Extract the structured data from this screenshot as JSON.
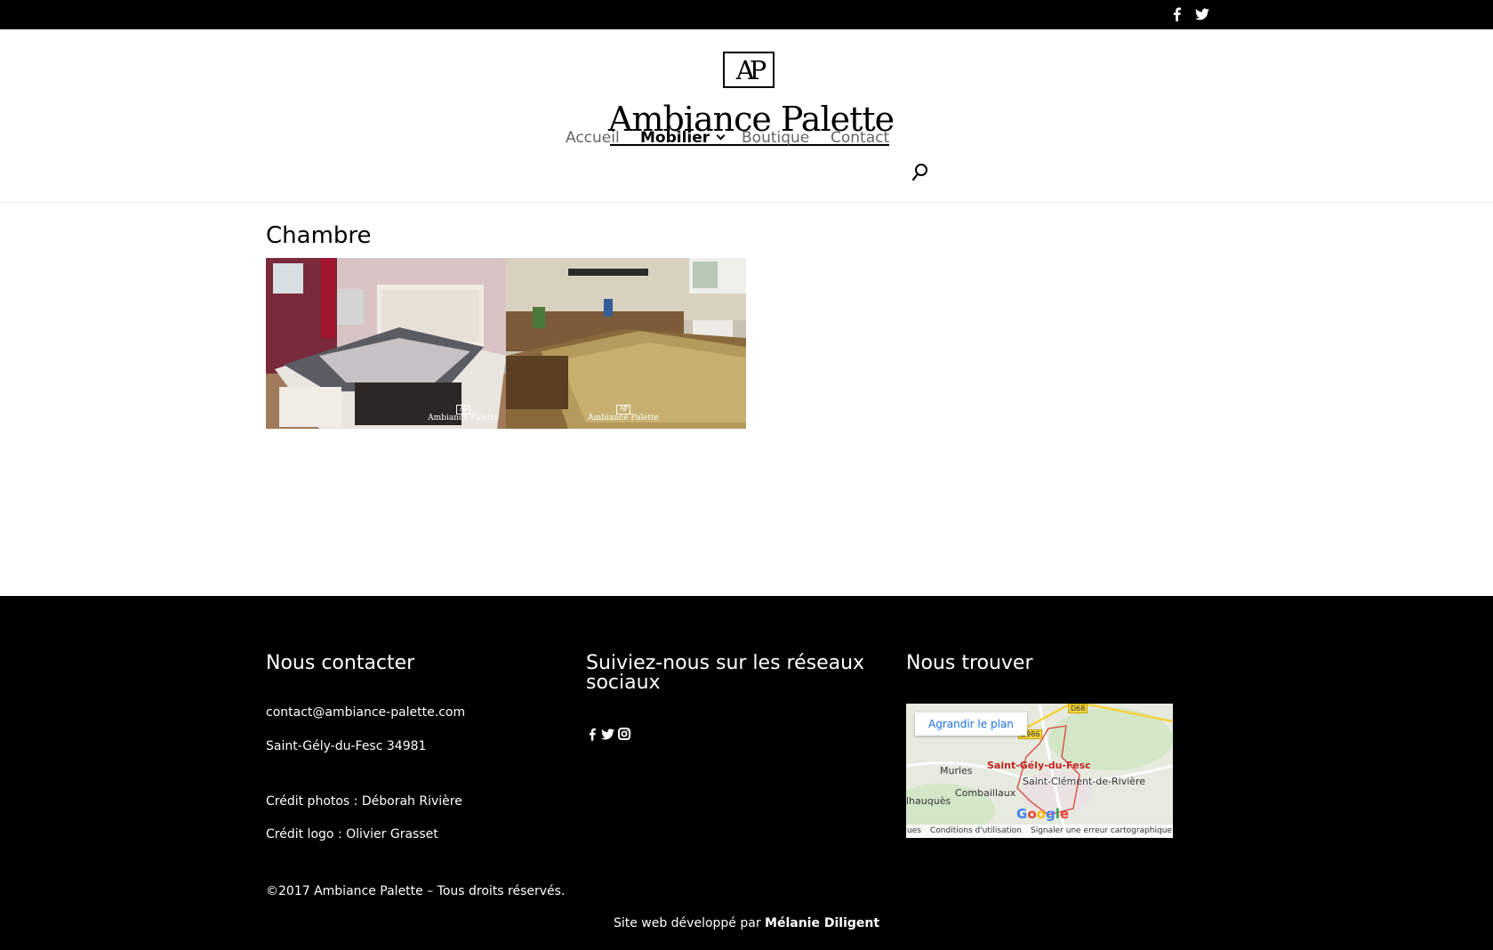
{
  "header": {
    "logo_monogram": "AP",
    "logo_name": "Ambiance Palette",
    "social_icons": [
      "facebook-icon",
      "twitter-icon"
    ]
  },
  "nav": {
    "items": [
      {
        "label": "Accueil",
        "active": false
      },
      {
        "label": "Mobilier",
        "active": true,
        "has_dropdown": true
      },
      {
        "label": "Boutique",
        "active": false
      },
      {
        "label": "Contact",
        "active": false
      }
    ],
    "search_icon": "search-icon"
  },
  "main": {
    "title": "Chambre",
    "gallery": [
      {
        "watermark_monogram": "AP",
        "watermark_name": "Ambiance Palette"
      },
      {
        "watermark_monogram": "AP",
        "watermark_name": "Ambiance Palette"
      }
    ]
  },
  "footer": {
    "contact": {
      "heading": "Nous contacter",
      "email": "contact@ambiance-palette.com",
      "address": "Saint-Gély-du-Fesc 34981",
      "photo_credit": "Crédit photos : Déborah Rivière",
      "logo_credit": "Crédit logo : Olivier Grasset"
    },
    "social": {
      "heading": "Suiviez-nous sur les réseaux sociaux",
      "icons": [
        "facebook-icon",
        "twitter-icon",
        "instagram-icon"
      ]
    },
    "find": {
      "heading": "Nous trouver",
      "map_button": "Agrandir le plan",
      "places": [
        "Saint-Gély-du-Fesc",
        "Murles",
        "Saint-Clément-de-Rivière",
        "Combaillaux",
        "lhauquès"
      ],
      "roads": [
        "D68",
        "D986"
      ],
      "map_brand": "Google",
      "map_footer": [
        "ues",
        "Conditions d'utilisation",
        "Signaler une erreur cartographique"
      ]
    },
    "copyright": "©2017 Ambiance Palette – Tous droits réservés.",
    "dev_prefix": "Site web développé par",
    "dev_name": "Mélanie Diligent"
  },
  "colors": {
    "top_bar": "#000000",
    "footer_bg": "#000000",
    "nav_text": "#666666",
    "nav_active": "#000000"
  }
}
